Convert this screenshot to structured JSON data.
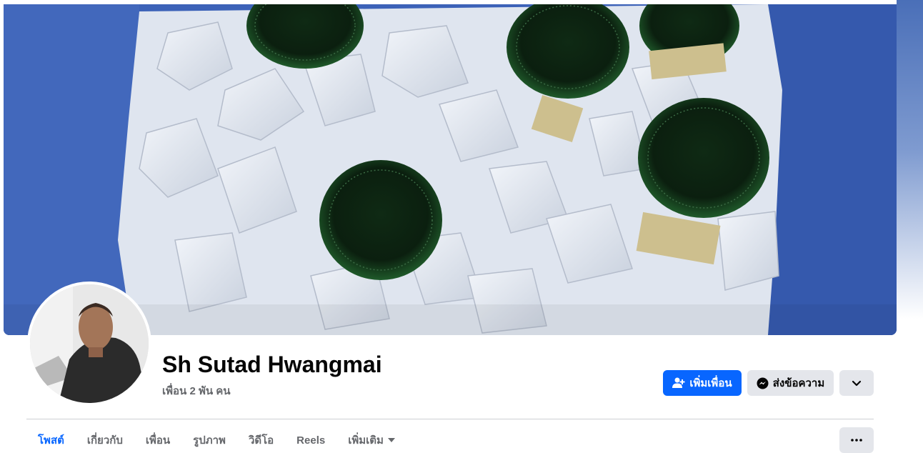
{
  "profile": {
    "name": "Sh Sutad Hwangmai",
    "friends_count": "เพื่อน 2 พัน คน"
  },
  "actions": {
    "add_friend": "เพิ่มเพื่อน",
    "message": "ส่งข้อความ"
  },
  "tabs": [
    {
      "label": "โพสต์",
      "active": true
    },
    {
      "label": "เกี่ยวกับ",
      "active": false
    },
    {
      "label": "เพื่อน",
      "active": false
    },
    {
      "label": "รูปภาพ",
      "active": false
    },
    {
      "label": "วิดีโอ",
      "active": false
    },
    {
      "label": "Reels",
      "active": false
    },
    {
      "label": "เพิ่มเติม",
      "active": false
    }
  ],
  "colors": {
    "accent": "#0866ff",
    "secondary_button": "#e4e6eb",
    "muted_text": "#65676b"
  },
  "icons": {
    "add_friend": "person-plus-icon",
    "message": "messenger-icon",
    "dropdown": "chevron-down-icon",
    "more": "ellipsis-icon",
    "tab_more": "caret-down-icon"
  }
}
